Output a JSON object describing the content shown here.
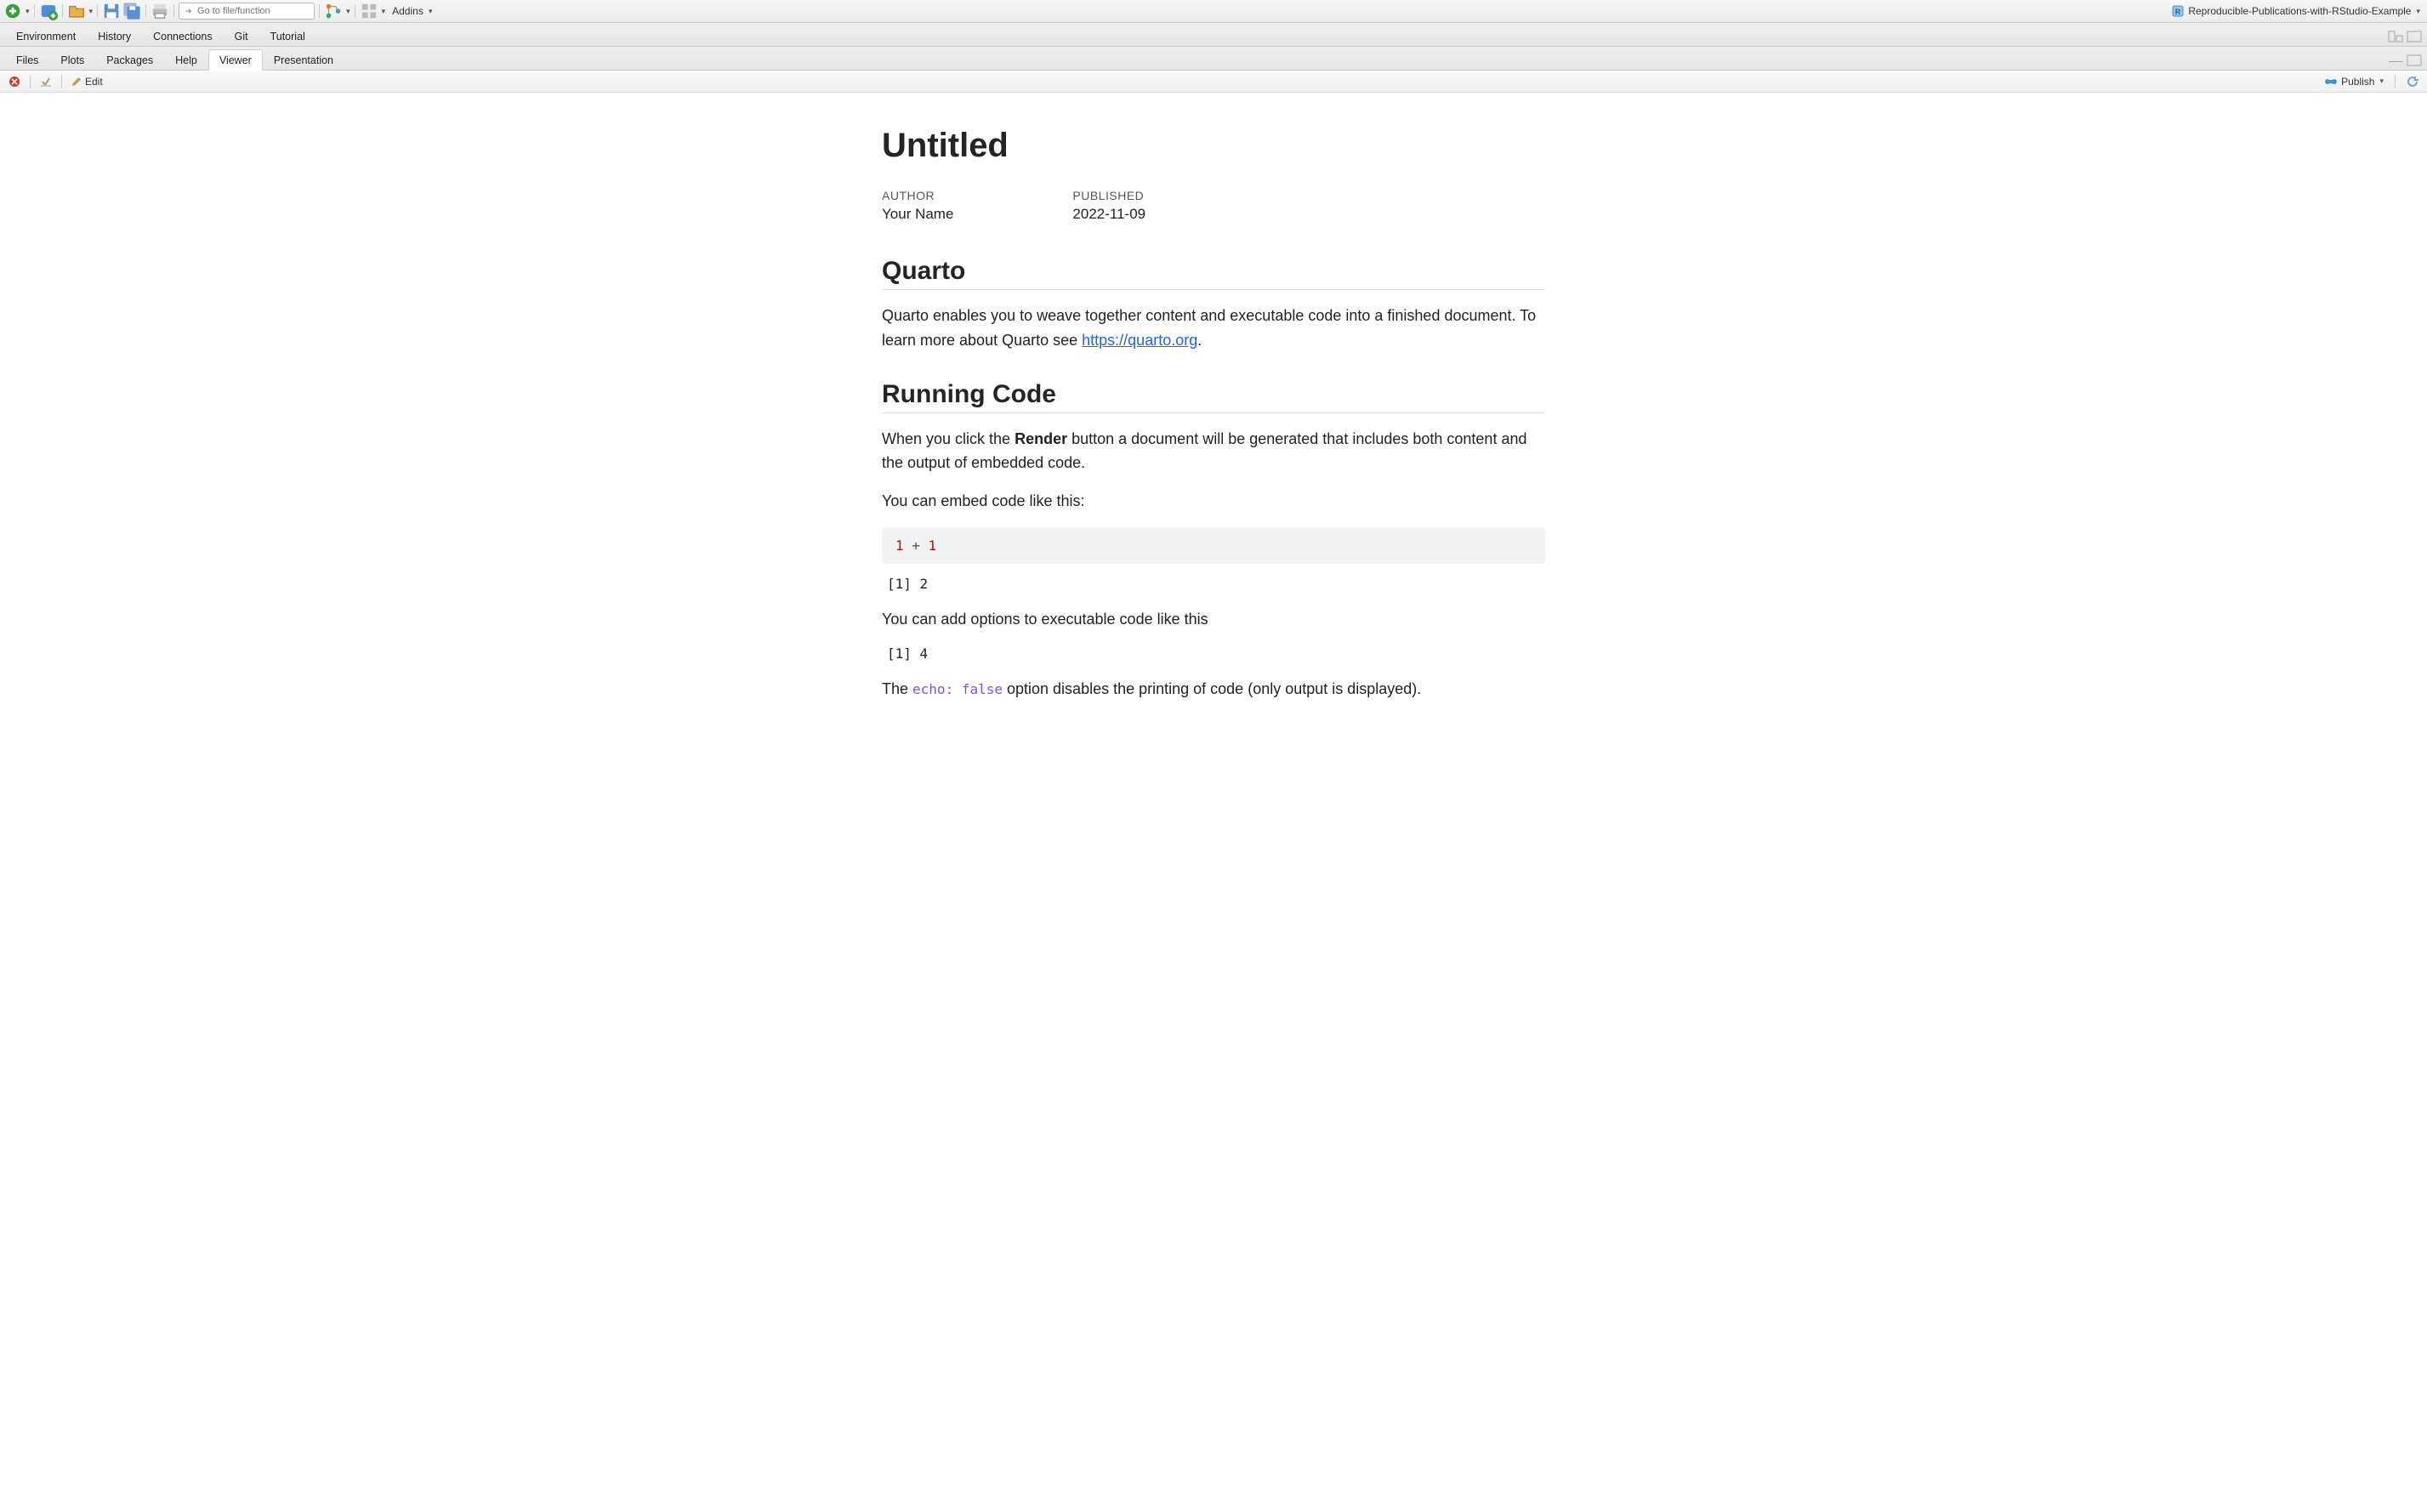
{
  "toolbar": {
    "goto_placeholder": "Go to file/function",
    "addins_label": "Addins",
    "project_name": "Reproducible-Publications-with-RStudio-Example"
  },
  "upper_tabs": [
    "Environment",
    "History",
    "Connections",
    "Git",
    "Tutorial"
  ],
  "lower_tabs": [
    "Files",
    "Plots",
    "Packages",
    "Help",
    "Viewer",
    "Presentation"
  ],
  "lower_active_index": 4,
  "viewer_toolbar": {
    "edit_label": "Edit",
    "publish_label": "Publish"
  },
  "doc": {
    "title": "Untitled",
    "author_label": "AUTHOR",
    "author_value": "Your Name",
    "published_label": "PUBLISHED",
    "published_value": "2022-11-09",
    "h2_quarto": "Quarto",
    "p_quarto_1a": "Quarto enables you to weave together content and executable code into a finished document. To learn more about Quarto see ",
    "p_quarto_link": "https://quarto.org",
    "p_quarto_1b": ".",
    "h2_running": "Running Code",
    "p_running_1a": "When you click the ",
    "p_running_1_strong": "Render",
    "p_running_1b": " button a document will be generated that includes both content and the output of embedded code.",
    "p_running_2": "You can embed code like this:",
    "code1_n1": "1",
    "code1_op": " + ",
    "code1_n2": "1",
    "output1": "[1] 2",
    "p_running_3": "You can add options to executable code like this",
    "output2": "[1] 4",
    "p_running_4a": "The ",
    "p_running_4_code": "echo: false",
    "p_running_4b": " option disables the printing of code (only output is displayed)."
  }
}
